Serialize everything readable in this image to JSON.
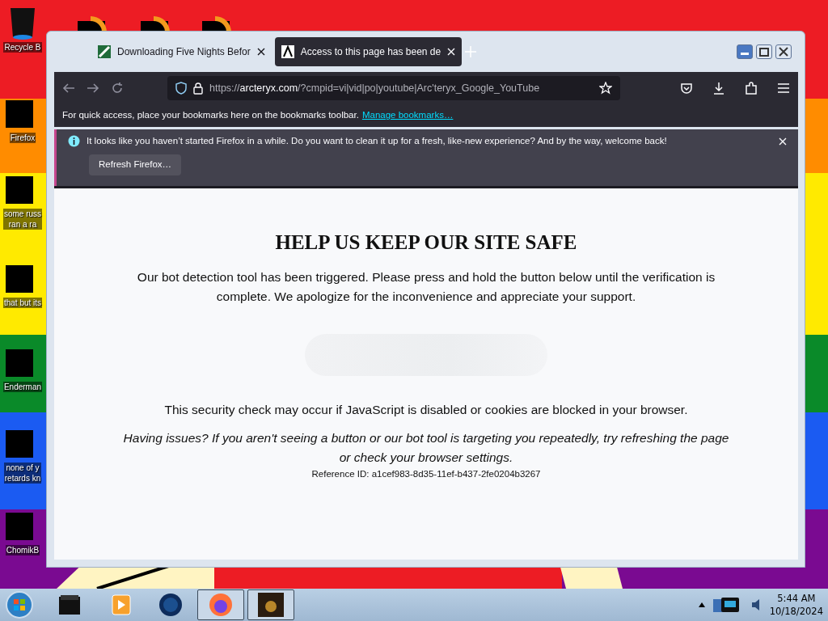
{
  "desktop_icons": [
    {
      "lines": [
        "Recycle B"
      ],
      "kind": "bin"
    },
    {
      "lines": [
        "Firefox"
      ],
      "kind": "redacted"
    },
    {
      "lines": [
        "some russ",
        "ran a ra"
      ],
      "kind": "redacted"
    },
    {
      "lines": [
        "that but its"
      ],
      "kind": "redacted"
    },
    {
      "lines": [
        "Enderman"
      ],
      "kind": "redacted"
    },
    {
      "lines": [
        "none of y",
        "retards kn"
      ],
      "kind": "redacted"
    },
    {
      "lines": [
        "ChomikB"
      ],
      "kind": "redacted"
    }
  ],
  "browser": {
    "tabs": [
      {
        "title": "Downloading Five Nights Befor",
        "selected": false
      },
      {
        "title": "Access to this page has been de",
        "selected": true
      }
    ],
    "url": {
      "scheme": "https://",
      "host": "arcteryx.com",
      "rest": "/?cmpid=vi|vid|po|youtube|Arc'teryx_Google_YouTube"
    },
    "bookmarks_bar": {
      "text": "For quick access, place your bookmarks here on the bookmarks toolbar.",
      "link": "Manage bookmarks…"
    },
    "notification": {
      "message": "It looks like you haven’t started Firefox in a while. Do you want to clean it up for a fresh, like-new experience? And by the way, welcome back!",
      "button": "Refresh Firefox…"
    },
    "page": {
      "heading": "HELP US KEEP OUR SITE SAFE",
      "paragraph": "Our bot detection tool has been triggered. Please press and hold the button below until the verification is complete. We apologize for the inconvenience and appreciate your support.",
      "note": "This security check may occur if JavaScript is disabled or cookies are blocked in your browser.",
      "issues": "Having issues? If you aren't seeing a button or our bot tool is targeting you repeatedly, try refreshing the page or check your browser settings.",
      "reference": "Reference ID: a1cef983-8d35-11ef-b437-2fe0204b3267"
    }
  },
  "taskbar": {
    "items": [
      {
        "kind": "folder",
        "selected": false
      },
      {
        "kind": "player",
        "selected": false
      },
      {
        "kind": "globe",
        "selected": false
      },
      {
        "kind": "firefox",
        "selected": true
      },
      {
        "kind": "game",
        "selected": true
      }
    ],
    "time": "5:44 AM",
    "date": "10/18/2024"
  }
}
